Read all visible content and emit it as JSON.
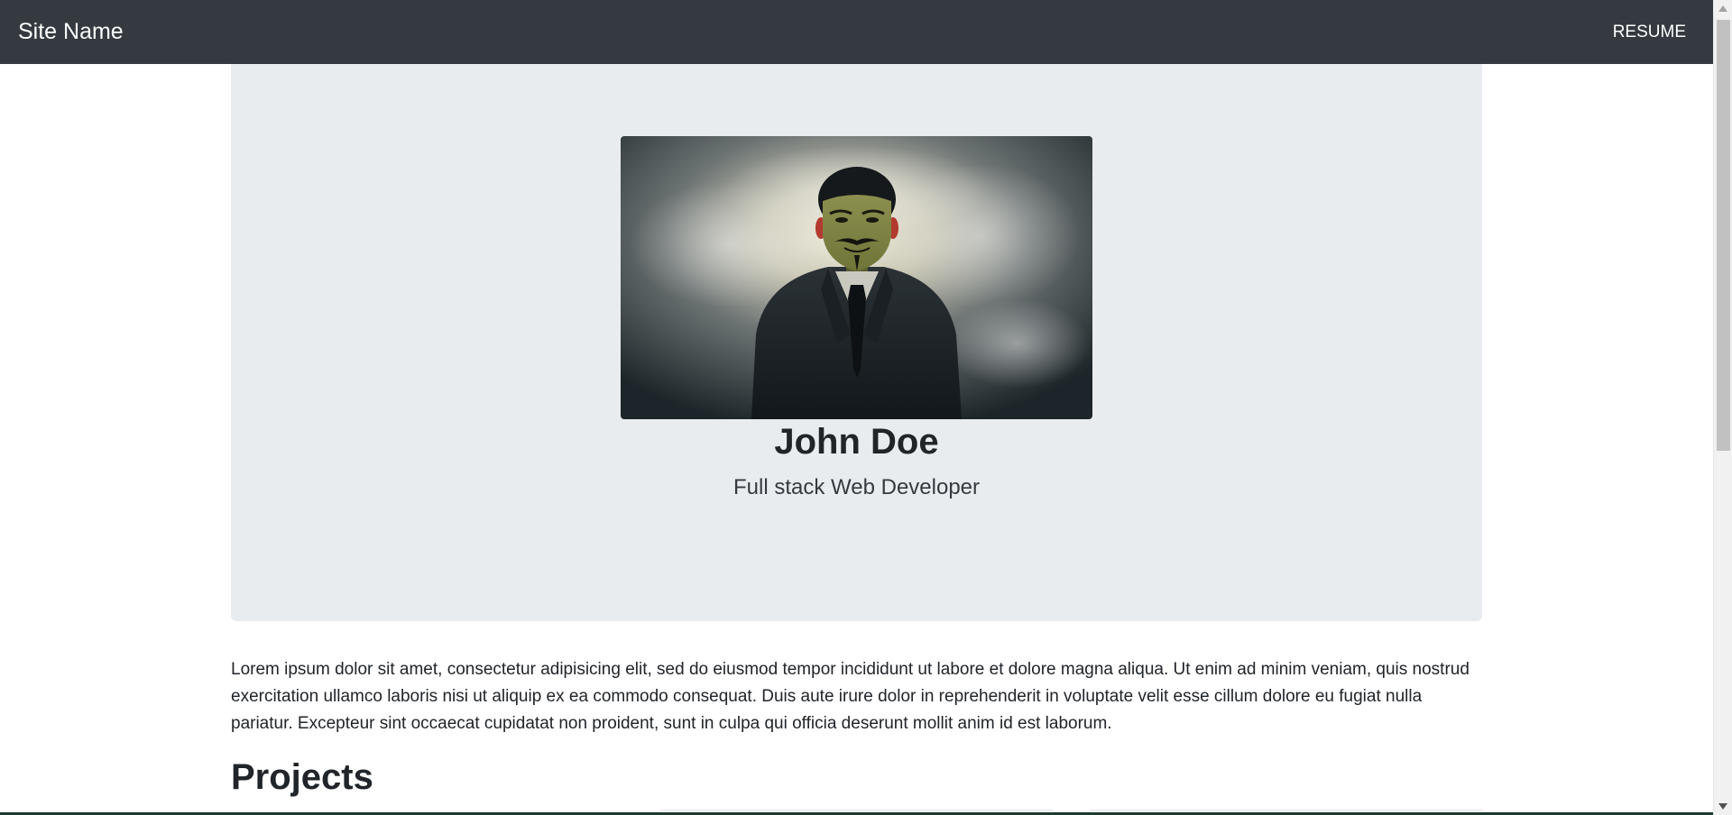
{
  "navbar": {
    "brand": "Site Name",
    "resume_link": "RESUME"
  },
  "hero": {
    "image_alt": "Person in a Guy Fawkes mask and suit surrounded by smoke",
    "name": "John Doe",
    "role": "Full stack Web Developer"
  },
  "intro": {
    "text": "Lorem ipsum dolor sit amet, consectetur adipisicing elit, sed do eiusmod tempor incididunt ut labore et dolore magna aliqua. Ut enim ad minim veniam, quis nostrud exercitation ullamco laboris nisi ut aliquip ex ea commodo consequat. Duis aute irure dolor in reprehenderit in voluptate velit esse cillum dolore eu fugiat nulla pariatur. Excepteur sint occaecat cupidatat non proident, sunt in culpa qui officia deserunt mollit anim id est laborum."
  },
  "projects": {
    "title": "Projects"
  },
  "colors": {
    "navbar": "#343a40",
    "jumbotron": "#e9ecef",
    "text": "#212529"
  }
}
